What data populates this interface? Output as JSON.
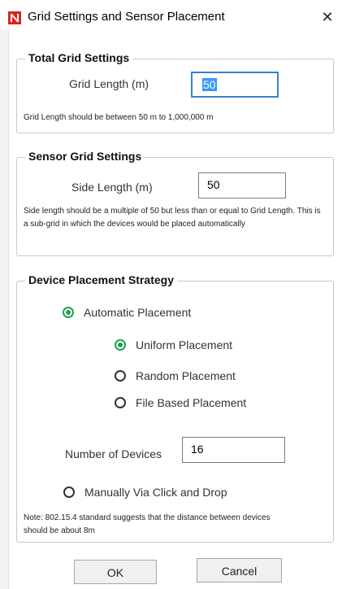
{
  "window": {
    "title": "Grid Settings and Sensor Placement",
    "close_glyph": "✕"
  },
  "total_grid": {
    "legend": "Total Grid Settings",
    "grid_length_label": "Grid Length (m)",
    "grid_length_value": "50",
    "hint": "Grid Length should be between 50 m to 1,000,000 m"
  },
  "sensor_grid": {
    "legend": "Sensor Grid Settings",
    "side_length_label": "Side Length (m)",
    "side_length_value": "50",
    "hint": "Side length should be a multiple of 50 but less than or equal to Grid Length. This is a sub-grid in which the devices would be placed automatically"
  },
  "placement": {
    "legend": "Device Placement Strategy",
    "automatic_label": "Automatic Placement",
    "uniform_label": "Uniform Placement",
    "random_label": "Random Placement",
    "file_label": "File Based Placement",
    "num_devices_label": "Number of Devices",
    "num_devices_value": "16",
    "manual_label": "Manually Via Click and Drop",
    "note": "Note: 802.15.4 standard suggests that the distance between devices should be about 8m"
  },
  "buttons": {
    "ok": "OK",
    "cancel": "Cancel"
  },
  "colors": {
    "accent_green": "#1e9f55",
    "focus_blue": "#3c7fd0",
    "icon_red": "#d9261c"
  }
}
